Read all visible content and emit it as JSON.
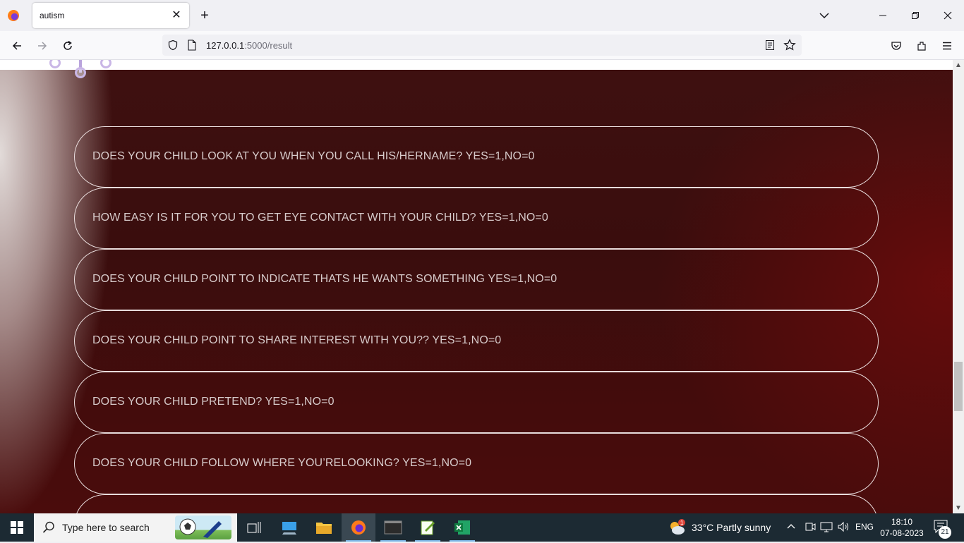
{
  "browser": {
    "tab_title": "autism",
    "url_host": "127.0.0.1",
    "url_path": ":5000/result"
  },
  "questions": [
    "DOES YOUR CHILD LOOK AT YOU WHEN YOU CALL HIS/HERNAME? YES=1,NO=0",
    "HOW EASY IS IT FOR YOU TO GET EYE CONTACT WITH YOUR CHILD? YES=1,NO=0",
    "DOES YOUR CHILD POINT TO INDICATE THATS HE WANTS SOMETHING YES=1,NO=0",
    "DOES YOUR CHILD POINT TO SHARE INTEREST WITH YOU?? YES=1,NO=0",
    "DOES YOUR CHILD PRETEND? YES=1,NO=0",
    "DOES YOUR CHILD FOLLOW WHERE YOU’RELOOKING? YES=1,NO=0"
  ],
  "taskbar": {
    "search_placeholder": "Type here to search",
    "weather": "33°C  Partly sunny",
    "weather_badge": "1",
    "language": "ENG",
    "time": "18:10",
    "date": "07-08-2023",
    "notification_count": "21"
  },
  "colors": {
    "page_bg": "#3a0c0c",
    "question_text": "#d7cbcb",
    "taskbar_bg": "#1c2a33"
  }
}
